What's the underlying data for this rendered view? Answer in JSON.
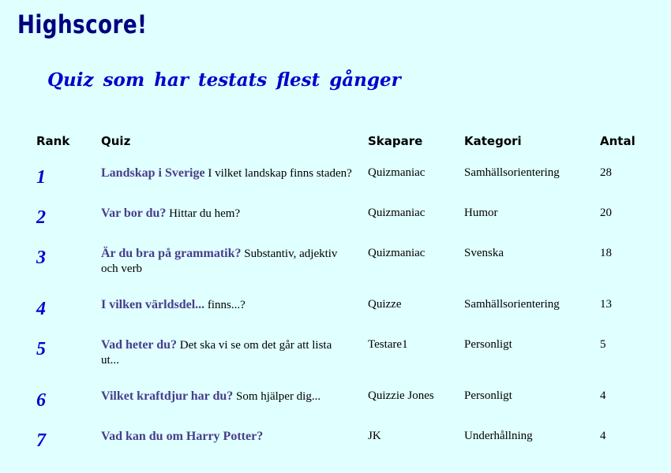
{
  "header": {
    "title": "Highscore!",
    "subtitle": "Quiz som har testats flest gånger"
  },
  "table": {
    "columns": [
      "Rank",
      "Quiz",
      "Skapare",
      "Kategori",
      "Antal"
    ],
    "rows": [
      {
        "rank": "1",
        "quiz_name": "Landskap i Sverige",
        "quiz_desc": "I vilket landskap finns staden?",
        "creator": "Quizmaniac",
        "category": "Samhällsorientering",
        "count": "28"
      },
      {
        "rank": "2",
        "quiz_name": "Var bor du?",
        "quiz_desc": "Hittar du hem?",
        "creator": "Quizmaniac",
        "category": "Humor",
        "count": "20"
      },
      {
        "rank": "3",
        "quiz_name": "Är du bra på grammatik?",
        "quiz_desc": "Substantiv, adjektiv och verb",
        "creator": "Quizmaniac",
        "category": "Svenska",
        "count": "18"
      },
      {
        "rank": "4",
        "quiz_name": "I vilken världsdel...",
        "quiz_desc": "finns...?",
        "creator": "Quizze",
        "category": "Samhällsorientering",
        "count": "13"
      },
      {
        "rank": "5",
        "quiz_name": "Vad heter du?",
        "quiz_desc": "Det ska vi se om det går att lista ut...",
        "creator": "Testare1",
        "category": "Personligt",
        "count": "5"
      },
      {
        "rank": "6",
        "quiz_name": "Vilket kraftdjur har du?",
        "quiz_desc": "Som hjälper dig...",
        "creator": "Quizzie Jones",
        "category": "Personligt",
        "count": "4"
      },
      {
        "rank": "7",
        "quiz_name": "Vad kan du om Harry Potter?",
        "quiz_desc": "",
        "creator": "JK",
        "category": "Underhållning",
        "count": "4"
      }
    ]
  }
}
